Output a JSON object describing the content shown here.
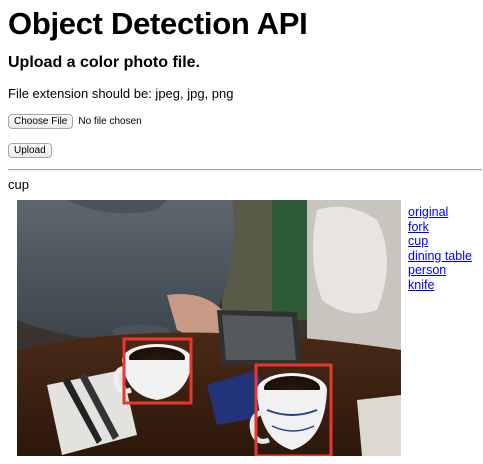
{
  "page": {
    "title": "Object Detection API",
    "subtitle": "Upload a color photo file.",
    "extension_note": "File extension should be: jpeg, jpg, png"
  },
  "form": {
    "choose_file_label": "Choose File",
    "file_status": "No file chosen",
    "upload_label": "Upload"
  },
  "result": {
    "detected_label": "cup",
    "links": [
      "original",
      "fork",
      "cup",
      "dining table",
      "person",
      "knife"
    ],
    "box_color": "#e8372b"
  },
  "colors": {
    "link": "#0000ee",
    "rule": "#a0a0a0"
  }
}
